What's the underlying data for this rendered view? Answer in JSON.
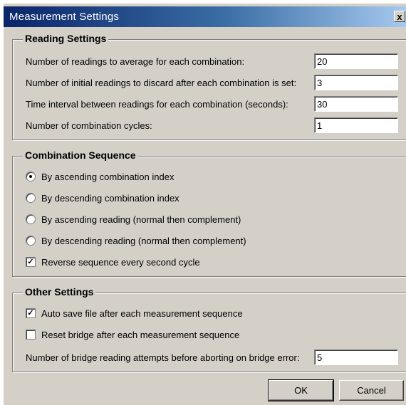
{
  "window": {
    "title": "Measurement Settings",
    "close_glyph": "x"
  },
  "reading_settings": {
    "title": "Reading Settings",
    "fields": [
      {
        "label": "Number of readings to average for each combination:",
        "value": "20"
      },
      {
        "label": "Number of initial readings to discard after each combination is set:",
        "value": "3"
      },
      {
        "label": "Time interval between readings for each combination (seconds):",
        "value": "30"
      },
      {
        "label": "Number of combination cycles:",
        "value": "1"
      }
    ]
  },
  "combination_sequence": {
    "title": "Combination Sequence",
    "options": [
      {
        "label": "By ascending combination index",
        "selected": true
      },
      {
        "label": "By descending combination index",
        "selected": false
      },
      {
        "label": "By ascending reading (normal then complement)",
        "selected": false
      },
      {
        "label": "By descending reading (normal then complement)",
        "selected": false
      }
    ],
    "reverse_checkbox": {
      "label": "Reverse sequence every second cycle",
      "checked": true
    }
  },
  "other_settings": {
    "title": "Other Settings",
    "checkboxes": [
      {
        "label": "Auto save file after each measurement sequence",
        "checked": true
      },
      {
        "label": "Reset bridge after each measurement sequence",
        "checked": false
      }
    ],
    "attempts_field": {
      "label": "Number of bridge reading attempts before aborting on bridge error:",
      "value": "5"
    }
  },
  "buttons": {
    "ok_label": "OK",
    "cancel_label": "Cancel"
  },
  "icons": {
    "check_glyph": "✓"
  }
}
